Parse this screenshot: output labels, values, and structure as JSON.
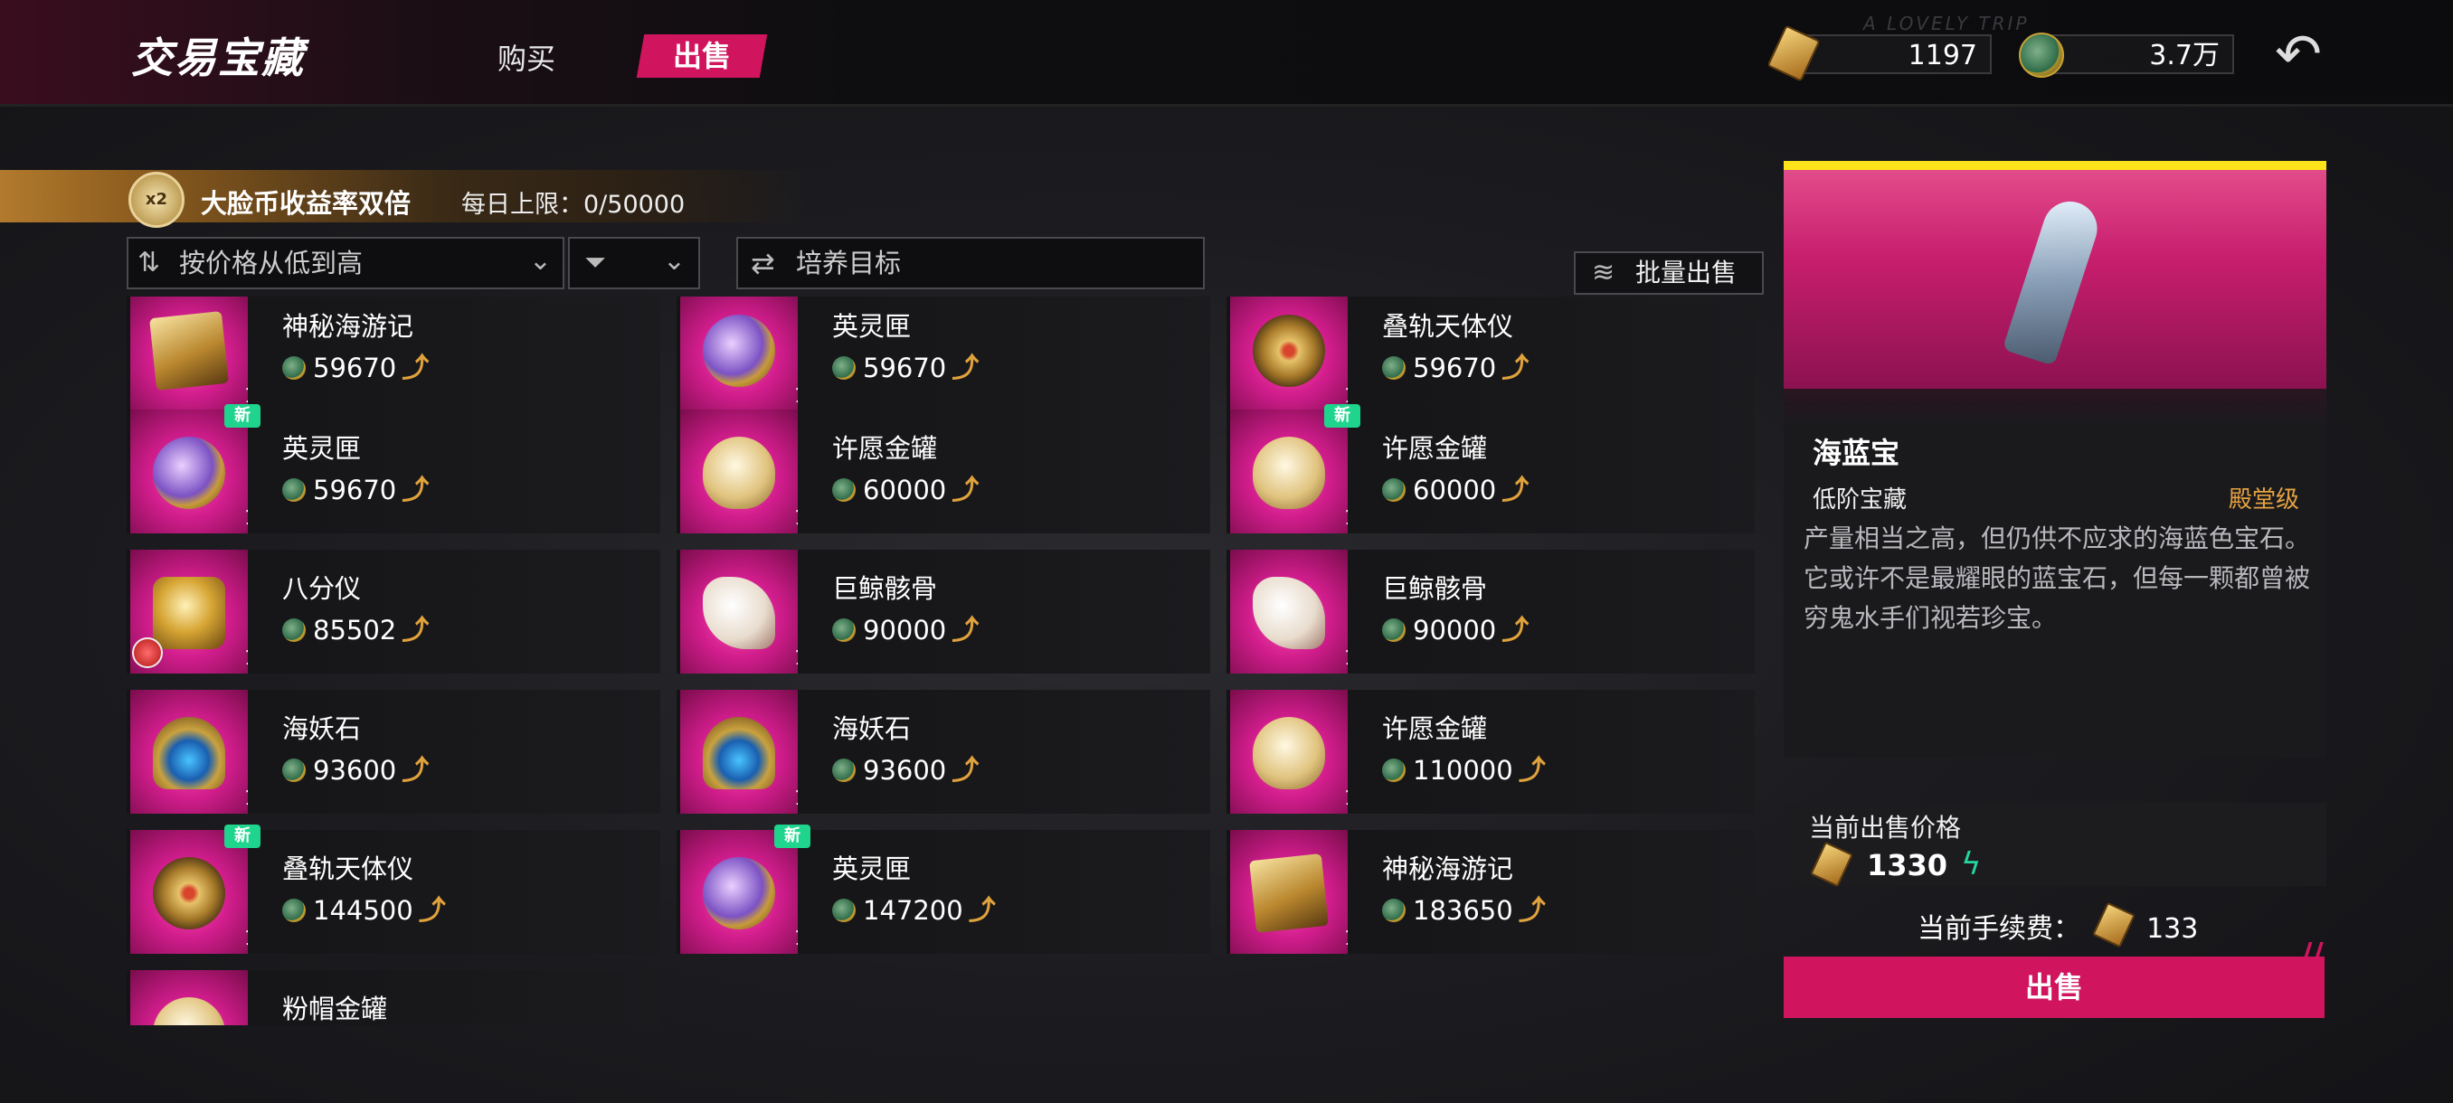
{
  "header": {
    "title": "交易宝藏",
    "tabs": [
      {
        "label": "购买"
      },
      {
        "label": "出售"
      }
    ],
    "active_tab": "出售",
    "gold_amount": "1197",
    "coin_amount": "3.7万",
    "decor_text": "A LOVELY TRIP"
  },
  "bonus": {
    "icon_text": "x2",
    "text": "大脸币收益率双倍",
    "daily_limit": "每日上限：0/50000"
  },
  "controls": {
    "sort_label": "按价格从低到高",
    "search_placeholder": "培养目标",
    "batch_sell": "批量出售"
  },
  "items": [
    {
      "name": "神秘海游记",
      "price": "59670",
      "qty": "1",
      "art": "book-icon"
    },
    {
      "name": "英灵匣",
      "price": "59670",
      "qty": "1",
      "art": "ornate-box-icon"
    },
    {
      "name": "叠轨天体仪",
      "price": "59670",
      "qty": "1",
      "art": "astrolabe-icon"
    },
    {
      "name": "英灵匣",
      "price": "59670",
      "qty": "1",
      "art": "ornate-box-icon",
      "new": "新"
    },
    {
      "name": "许愿金罐",
      "price": "60000",
      "qty": "1",
      "art": "hamster-jar-icon"
    },
    {
      "name": "许愿金罐",
      "price": "60000",
      "qty": "1",
      "art": "hamster-jar-icon",
      "new": "新"
    },
    {
      "name": "八分仪",
      "price": "85502",
      "qty": "1",
      "art": "octant-icon"
    },
    {
      "name": "巨鲸骸骨",
      "price": "90000",
      "qty": "1",
      "art": "whale-skull-icon"
    },
    {
      "name": "巨鲸骸骨",
      "price": "90000",
      "qty": "1",
      "art": "whale-skull-icon"
    },
    {
      "name": "海妖石",
      "price": "93600",
      "qty": "1",
      "art": "siren-stone-icon"
    },
    {
      "name": "海妖石",
      "price": "93600",
      "qty": "1",
      "art": "siren-stone-icon"
    },
    {
      "name": "许愿金罐",
      "price": "110000",
      "qty": "1",
      "art": "hamster-jar-icon"
    },
    {
      "name": "叠轨天体仪",
      "price": "144500",
      "qty": "1",
      "art": "astrolabe-icon",
      "new": "新"
    },
    {
      "name": "英灵匣",
      "price": "147200",
      "qty": "1",
      "art": "ornate-box-icon",
      "new": "新"
    },
    {
      "name": "神秘海游记",
      "price": "183650",
      "qty": "1",
      "art": "book-icon"
    },
    {
      "name": "粉帽金罐",
      "price": "",
      "qty": "",
      "art": "hamster-jar-icon"
    }
  ],
  "detail": {
    "name": "海蓝宝",
    "tier": "低阶宝藏",
    "rank": "殿堂级",
    "description": "产量相当之高，但仍供不应求的海蓝色宝石。\n它或许不是最耀眼的蓝宝石，但每一颗都曾被穷鬼水手们视若珍宝。",
    "current_price_label": "当前出售价格",
    "current_price": "1330",
    "fee_label": "当前手续费：",
    "fee_value": "133",
    "sell_button": "出售"
  },
  "colors": {
    "accent": "#d0145e",
    "new_badge": "#1fd48d",
    "rank_gold": "#e6a340",
    "panel_top": "#ffe31a"
  }
}
